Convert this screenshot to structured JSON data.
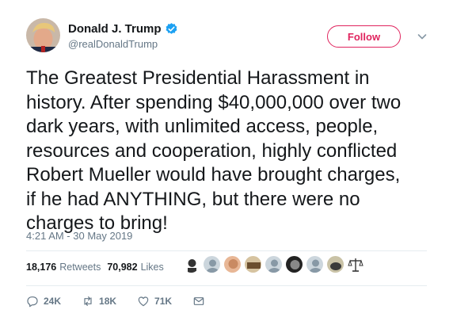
{
  "user": {
    "name": "Donald J. Trump",
    "handle": "@realDonaldTrump",
    "verified": true
  },
  "follow_label": "Follow",
  "tweet": {
    "text": "The Greatest Presidential Harassment in\nhistory. After spending $40,000,000 over two\ndark years, with unlimited access, people,\nresources and cooperation, highly conflicted\nRobert Mueller would have brought charges,\nif he had ANYTHING, but there were no\ncharges to bring!",
    "timestamp": "4:21 AM - 30 May 2019"
  },
  "stats": {
    "retweets_count": "18,176",
    "retweets_label": "Retweets",
    "likes_count": "70,982",
    "likes_label": "Likes"
  },
  "actions": {
    "reply_count": "24K",
    "retweet_count": "18K",
    "like_count": "71K"
  },
  "colors": {
    "accent": "#e0245e",
    "verified": "#1da1f2",
    "secondary_text": "#657786"
  },
  "icons": {
    "verified": "verified-badge-icon",
    "chevron": "chevron-down-icon",
    "reply": "reply-icon",
    "retweet": "retweet-icon",
    "like": "heart-icon",
    "dm": "envelope-icon",
    "scales": "scales-icon"
  }
}
